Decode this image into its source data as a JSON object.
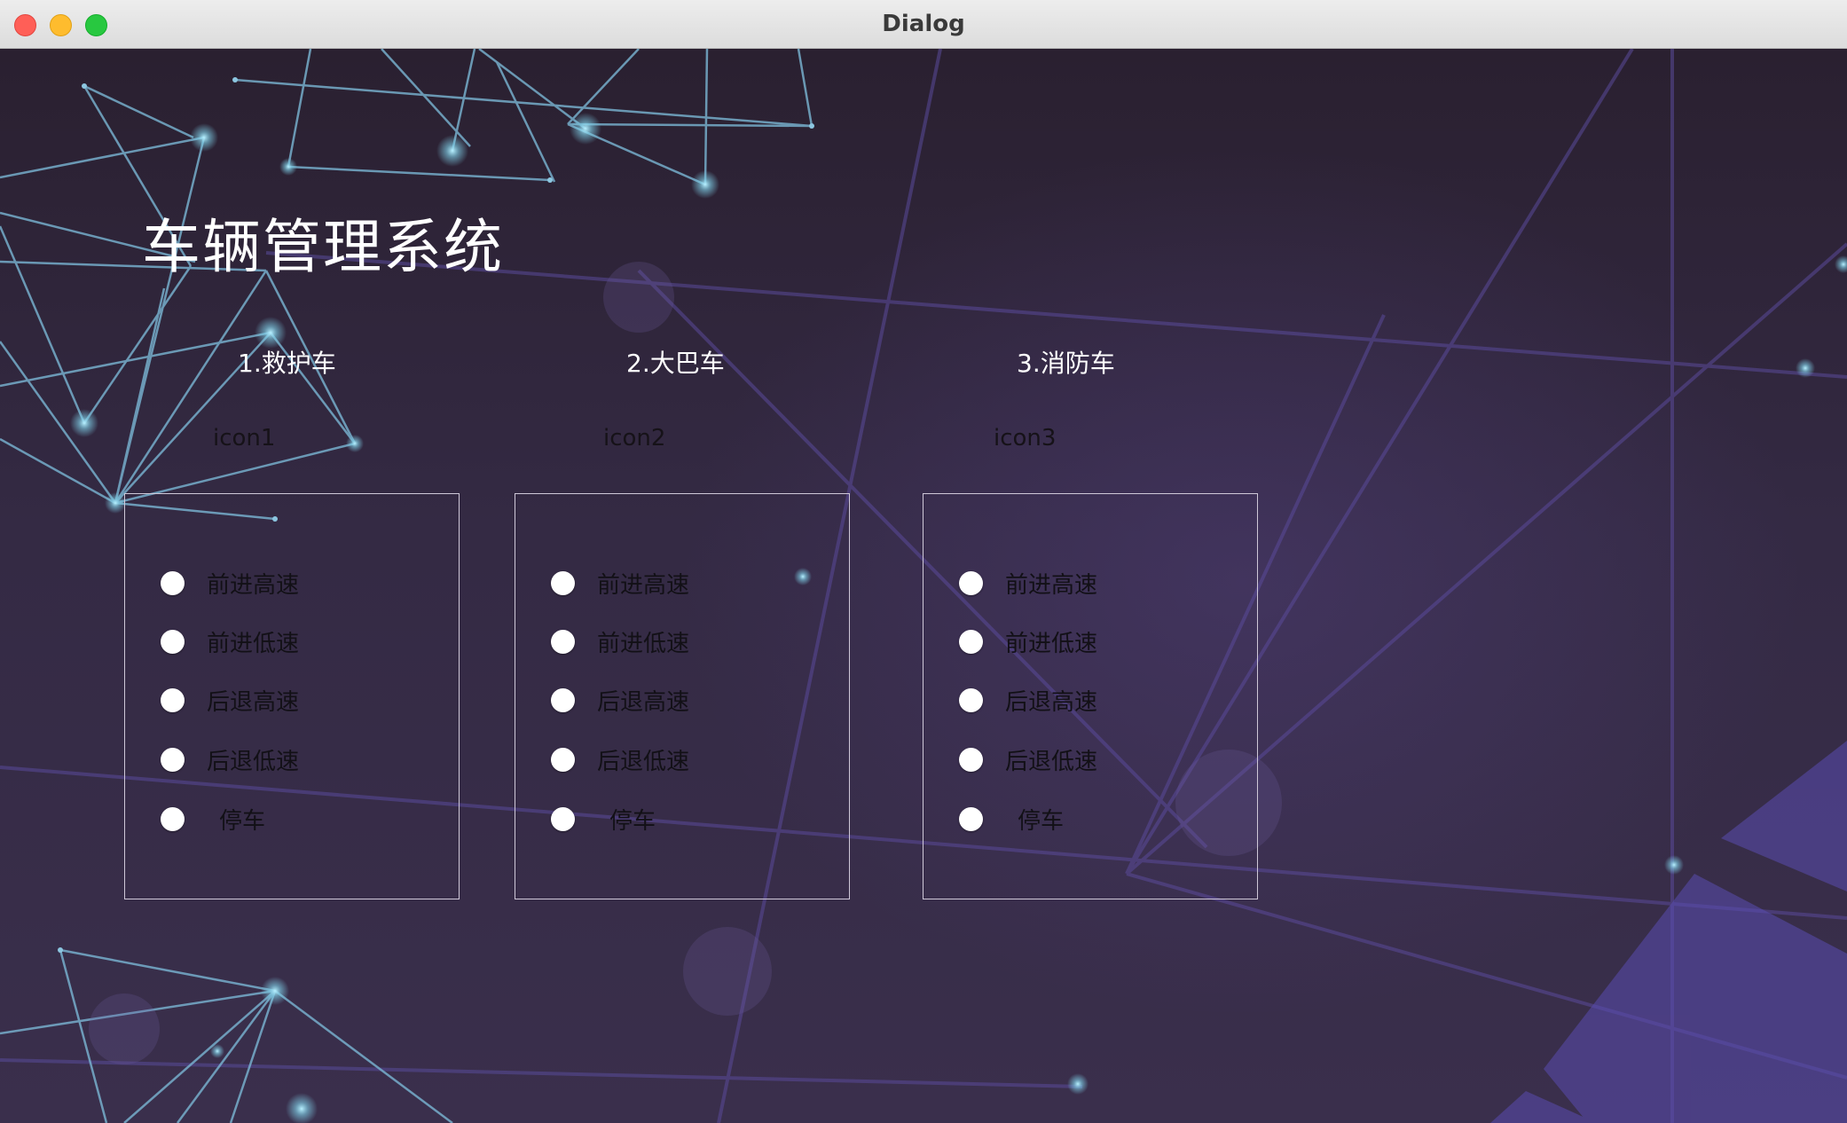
{
  "window": {
    "title": "Dialog"
  },
  "app": {
    "title": "车辆管理系统"
  },
  "vehicles": [
    {
      "label": "1.救护车",
      "icon_label": "icon1",
      "options": [
        "前进高速",
        "前进低速",
        "后退高速",
        "后退低速",
        "停车"
      ]
    },
    {
      "label": "2.大巴车",
      "icon_label": "icon2",
      "options": [
        "前进高速",
        "前进低速",
        "后退高速",
        "后退低速",
        "停车"
      ]
    },
    {
      "label": "3.消防车",
      "icon_label": "icon3",
      "options": [
        "前进高速",
        "前进低速",
        "后退高速",
        "后退低速",
        "停车"
      ]
    }
  ],
  "colors": {
    "background": "#2b2232",
    "network_lines": "#7fb7d6",
    "accent_purple": "#5b4aa8",
    "radio": "#ffffff"
  }
}
